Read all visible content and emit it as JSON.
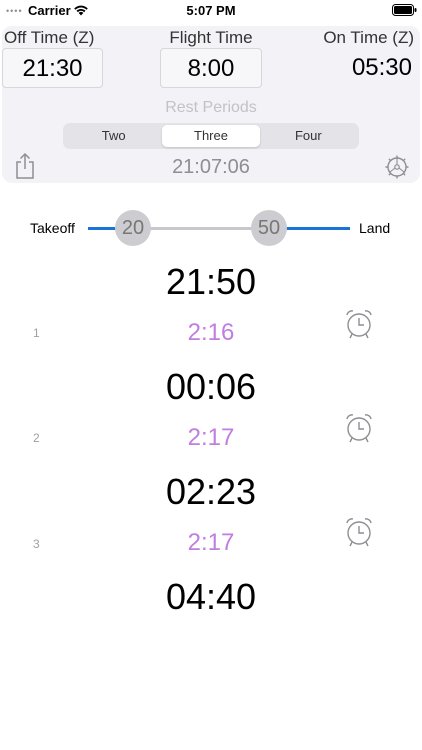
{
  "status_bar": {
    "signal": "••••",
    "carrier": "Carrier",
    "time": "5:07 PM",
    "wifi_icon": "wifi-icon",
    "battery_icon": "battery-icon"
  },
  "header": {
    "off_time_label": "Off Time (Z)",
    "off_time_value": "21:30",
    "flight_time_label": "Flight Time",
    "flight_time_value": "8:00",
    "on_time_label": "On Time (Z)",
    "on_time_value": "05:30"
  },
  "rest_periods": {
    "label": "Rest Periods",
    "options": [
      "Two",
      "Three",
      "Four"
    ],
    "selected": "Three"
  },
  "toolbar": {
    "current_time": "21:07:06",
    "share_icon": "share-icon",
    "settings_icon": "gear-icon"
  },
  "slider": {
    "takeoff_label": "Takeoff",
    "land_label": "Land",
    "left_value": "20",
    "right_value": "50"
  },
  "schedule": {
    "times": [
      "21:50",
      "00:06",
      "02:23",
      "04:40"
    ],
    "rests": [
      {
        "number": "1",
        "duration": "2:16"
      },
      {
        "number": "2",
        "duration": "2:17"
      },
      {
        "number": "3",
        "duration": "2:17"
      }
    ],
    "alarm_icon": "alarm-clock-icon"
  },
  "colors": {
    "accent_blue": "#1a73d9",
    "rest_purple": "#c17ee0",
    "panel_bg": "#f2f2f7"
  }
}
